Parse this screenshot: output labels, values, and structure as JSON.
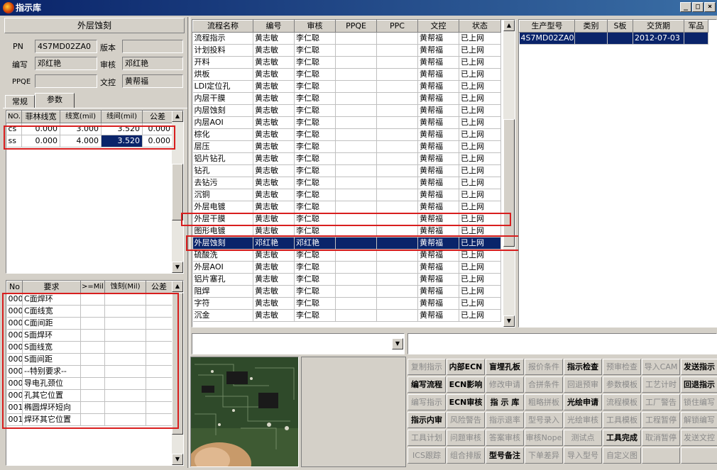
{
  "window": {
    "title": "指示库",
    "controls": [
      "_",
      "□",
      "×"
    ]
  },
  "header": {
    "title": "外层蚀刻"
  },
  "form": {
    "pn_label": "PN",
    "pn_value": "4S7MD02ZA0",
    "version_label": "版本",
    "version_value": "",
    "writer_label": "编写",
    "writer_value": "邓红艳",
    "reviewer_label": "审核",
    "reviewer_value": "邓红艳",
    "ppqe_label": "PPQE",
    "ppqe_value": "",
    "doc_label": "文控",
    "doc_value": "黄帮福"
  },
  "tabs": [
    "常规",
    "参数"
  ],
  "params": {
    "columns": [
      "NO.",
      "菲林线宽",
      "线宽(mil)",
      "线间(mil)",
      "公差"
    ],
    "rows": [
      [
        "cs",
        "0.000",
        "3.000",
        "3.520",
        "0.000"
      ],
      [
        "ss",
        "0.000",
        "4.000",
        "3.520",
        "0.000"
      ]
    ]
  },
  "reqs": {
    "columns": [
      "No",
      "要求",
      ">=Mil",
      "蚀刻(Mil)",
      "公差"
    ],
    "rows": [
      [
        "000",
        "C面焊环"
      ],
      [
        "000",
        "C面线宽"
      ],
      [
        "000",
        "C面间距"
      ],
      [
        "000",
        "S面焊环"
      ],
      [
        "000",
        "S面线宽"
      ],
      [
        "000",
        "S面间距"
      ],
      [
        "000",
        "--特别要求--"
      ],
      [
        "000",
        "导电孔颈位"
      ],
      [
        "000",
        "孔其它位置"
      ],
      [
        "001",
        "椭圆焊环短向"
      ],
      [
        "001",
        "焊环其它位置"
      ]
    ]
  },
  "process": {
    "columns": [
      "流程名称",
      "编号",
      "审核",
      "PPQE",
      "PPC",
      "文控",
      "状态"
    ],
    "rows": [
      [
        "流程指示",
        "黄志敏",
        "李仁聪",
        "",
        "",
        "黄帮福",
        "已上网"
      ],
      [
        "计划投料",
        "黄志敏",
        "李仁聪",
        "",
        "",
        "黄帮福",
        "已上网"
      ],
      [
        "开料",
        "黄志敏",
        "李仁聪",
        "",
        "",
        "黄帮福",
        "已上网"
      ],
      [
        "烘板",
        "黄志敏",
        "李仁聪",
        "",
        "",
        "黄帮福",
        "已上网"
      ],
      [
        "LDI定位孔",
        "黄志敏",
        "李仁聪",
        "",
        "",
        "黄帮福",
        "已上网"
      ],
      [
        "内层干膜",
        "黄志敏",
        "李仁聪",
        "",
        "",
        "黄帮福",
        "已上网"
      ],
      [
        "内层蚀刻",
        "黄志敏",
        "李仁聪",
        "",
        "",
        "黄帮福",
        "已上网"
      ],
      [
        "内层AOI",
        "黄志敏",
        "李仁聪",
        "",
        "",
        "黄帮福",
        "已上网"
      ],
      [
        "棕化",
        "黄志敏",
        "李仁聪",
        "",
        "",
        "黄帮福",
        "已上网"
      ],
      [
        "层压",
        "黄志敏",
        "李仁聪",
        "",
        "",
        "黄帮福",
        "已上网"
      ],
      [
        "铝片钻孔",
        "黄志敏",
        "李仁聪",
        "",
        "",
        "黄帮福",
        "已上网"
      ],
      [
        "钻孔",
        "黄志敏",
        "李仁聪",
        "",
        "",
        "黄帮福",
        "已上网"
      ],
      [
        "去钻污",
        "黄志敏",
        "李仁聪",
        "",
        "",
        "黄帮福",
        "已上网"
      ],
      [
        "沉铜",
        "黄志敏",
        "李仁聪",
        "",
        "",
        "黄帮福",
        "已上网"
      ],
      [
        "外层电镀",
        "黄志敏",
        "李仁聪",
        "",
        "",
        "黄帮福",
        "已上网"
      ],
      [
        "外层干膜",
        "黄志敏",
        "李仁聪",
        "",
        "",
        "黄帮福",
        "已上网"
      ],
      [
        "图形电镀",
        "黄志敏",
        "李仁聪",
        "",
        "",
        "黄帮福",
        "已上网"
      ],
      [
        "外层蚀刻",
        "邓红艳",
        "邓红艳",
        "",
        "",
        "黄帮福",
        "已上网"
      ],
      [
        "硫酸洗",
        "黄志敏",
        "李仁聪",
        "",
        "",
        "黄帮福",
        "已上网"
      ],
      [
        "外层AOI",
        "黄志敏",
        "李仁聪",
        "",
        "",
        "黄帮福",
        "已上网"
      ],
      [
        "铝片塞孔",
        "黄志敏",
        "李仁聪",
        "",
        "",
        "黄帮福",
        "已上网"
      ],
      [
        "阻焊",
        "黄志敏",
        "李仁聪",
        "",
        "",
        "黄帮福",
        "已上网"
      ],
      [
        "字符",
        "黄志敏",
        "李仁聪",
        "",
        "",
        "黄帮福",
        "已上网"
      ],
      [
        "沉金",
        "黄志敏",
        "李仁聪",
        "",
        "",
        "黄帮福",
        "已上网"
      ]
    ]
  },
  "orders": {
    "columns": [
      "生产型号",
      "类别",
      "S板",
      "交货期",
      "军品"
    ],
    "rows": [
      [
        "4S7MD02ZA0",
        "",
        "",
        "2012-07-03",
        ""
      ]
    ]
  },
  "buttons": [
    [
      "复制指示",
      "内部ECN",
      "盲埋孔板",
      "报价条件",
      "指示检查",
      "预审检查",
      "导入CAM",
      "发送指示"
    ],
    [
      "编写流程",
      "ECN影响",
      "修改申请",
      "合拼条件",
      "回退预审",
      "参数模板",
      "工艺计时",
      "回退指示"
    ],
    [
      "编写指示",
      "ECN审核",
      "指 示 库",
      "粗略拼板",
      "光绘申请",
      "流程模板",
      "工厂警告",
      "锁住编写"
    ],
    [
      "指示内审",
      "风险警告",
      "指示退率",
      "型号录入",
      "光绘审核",
      "工具模板",
      "工程暂停",
      "解锁编写"
    ],
    [
      "工具计划",
      "问题审核",
      "答案审核",
      "审核Nope",
      "测试点",
      "工具完成",
      "取消暂停",
      "发送文控"
    ],
    [
      "ICS跟踪",
      "组合排版",
      "型号备注",
      "下单差异",
      "导入型号",
      "自定义图",
      "",
      ""
    ]
  ],
  "button_enabled": [
    [
      false,
      true,
      true,
      false,
      true,
      false,
      false,
      true
    ],
    [
      true,
      true,
      false,
      false,
      false,
      false,
      false,
      true
    ],
    [
      false,
      true,
      true,
      false,
      true,
      false,
      false,
      false
    ],
    [
      true,
      false,
      false,
      false,
      false,
      false,
      false,
      false
    ],
    [
      false,
      false,
      false,
      false,
      false,
      true,
      false,
      false
    ],
    [
      false,
      false,
      true,
      false,
      false,
      false,
      false,
      false
    ]
  ]
}
